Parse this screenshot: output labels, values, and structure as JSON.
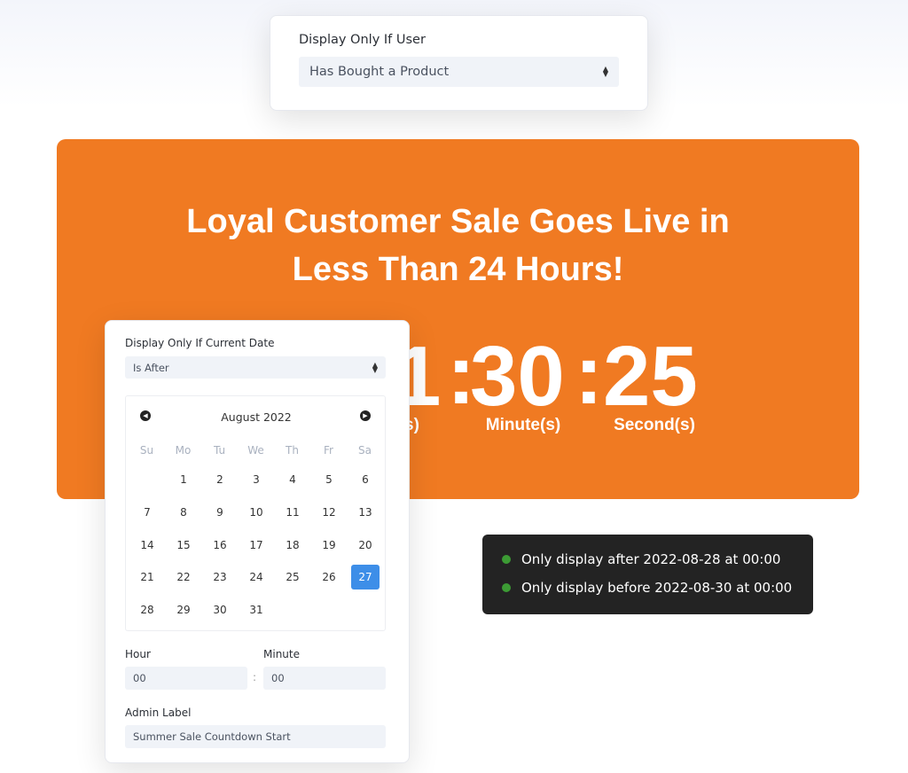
{
  "user_card": {
    "label": "Display Only If User",
    "value": "Has Bought a Product"
  },
  "banner": {
    "title_line1": "Loyal Customer Sale Goes Live in",
    "title_line2": "Less Than 24 Hours!",
    "color": "#F07A22",
    "countdown": {
      "hours_visible": "1",
      "hours_label_visible": "s)",
      "minutes": "30",
      "minutes_label": "Minute(s)",
      "seconds": "25",
      "seconds_label": "Second(s)",
      "separator": ":"
    }
  },
  "date_panel": {
    "label": "Display Only If Current Date",
    "condition": "Is After",
    "calendar": {
      "month": "August 2022",
      "weekdays": [
        "Su",
        "Mo",
        "Tu",
        "We",
        "Th",
        "Fr",
        "Sa"
      ],
      "weeks": [
        [
          null,
          "1",
          "2",
          "3",
          "4",
          "5",
          "6"
        ],
        [
          "7",
          "8",
          "9",
          "10",
          "11",
          "12",
          "13"
        ],
        [
          "14",
          "15",
          "16",
          "17",
          "18",
          "19",
          "20"
        ],
        [
          "21",
          "22",
          "23",
          "24",
          "25",
          "26",
          "27"
        ],
        [
          "28",
          "29",
          "30",
          "31",
          null,
          null,
          null
        ]
      ],
      "selected": "27",
      "selected_color": "#3d8ee8"
    },
    "hour_label": "Hour",
    "hour_value": "00",
    "minute_label": "Minute",
    "minute_value": "00",
    "time_separator": ":",
    "admin_label": "Admin Label",
    "admin_value": "Summer Sale Countdown Start"
  },
  "tooltip": {
    "lines": [
      "Only display after 2022-08-28 at 00:00",
      "Only display before 2022-08-30 at 00:00"
    ],
    "dot_color": "#3c9b34"
  }
}
